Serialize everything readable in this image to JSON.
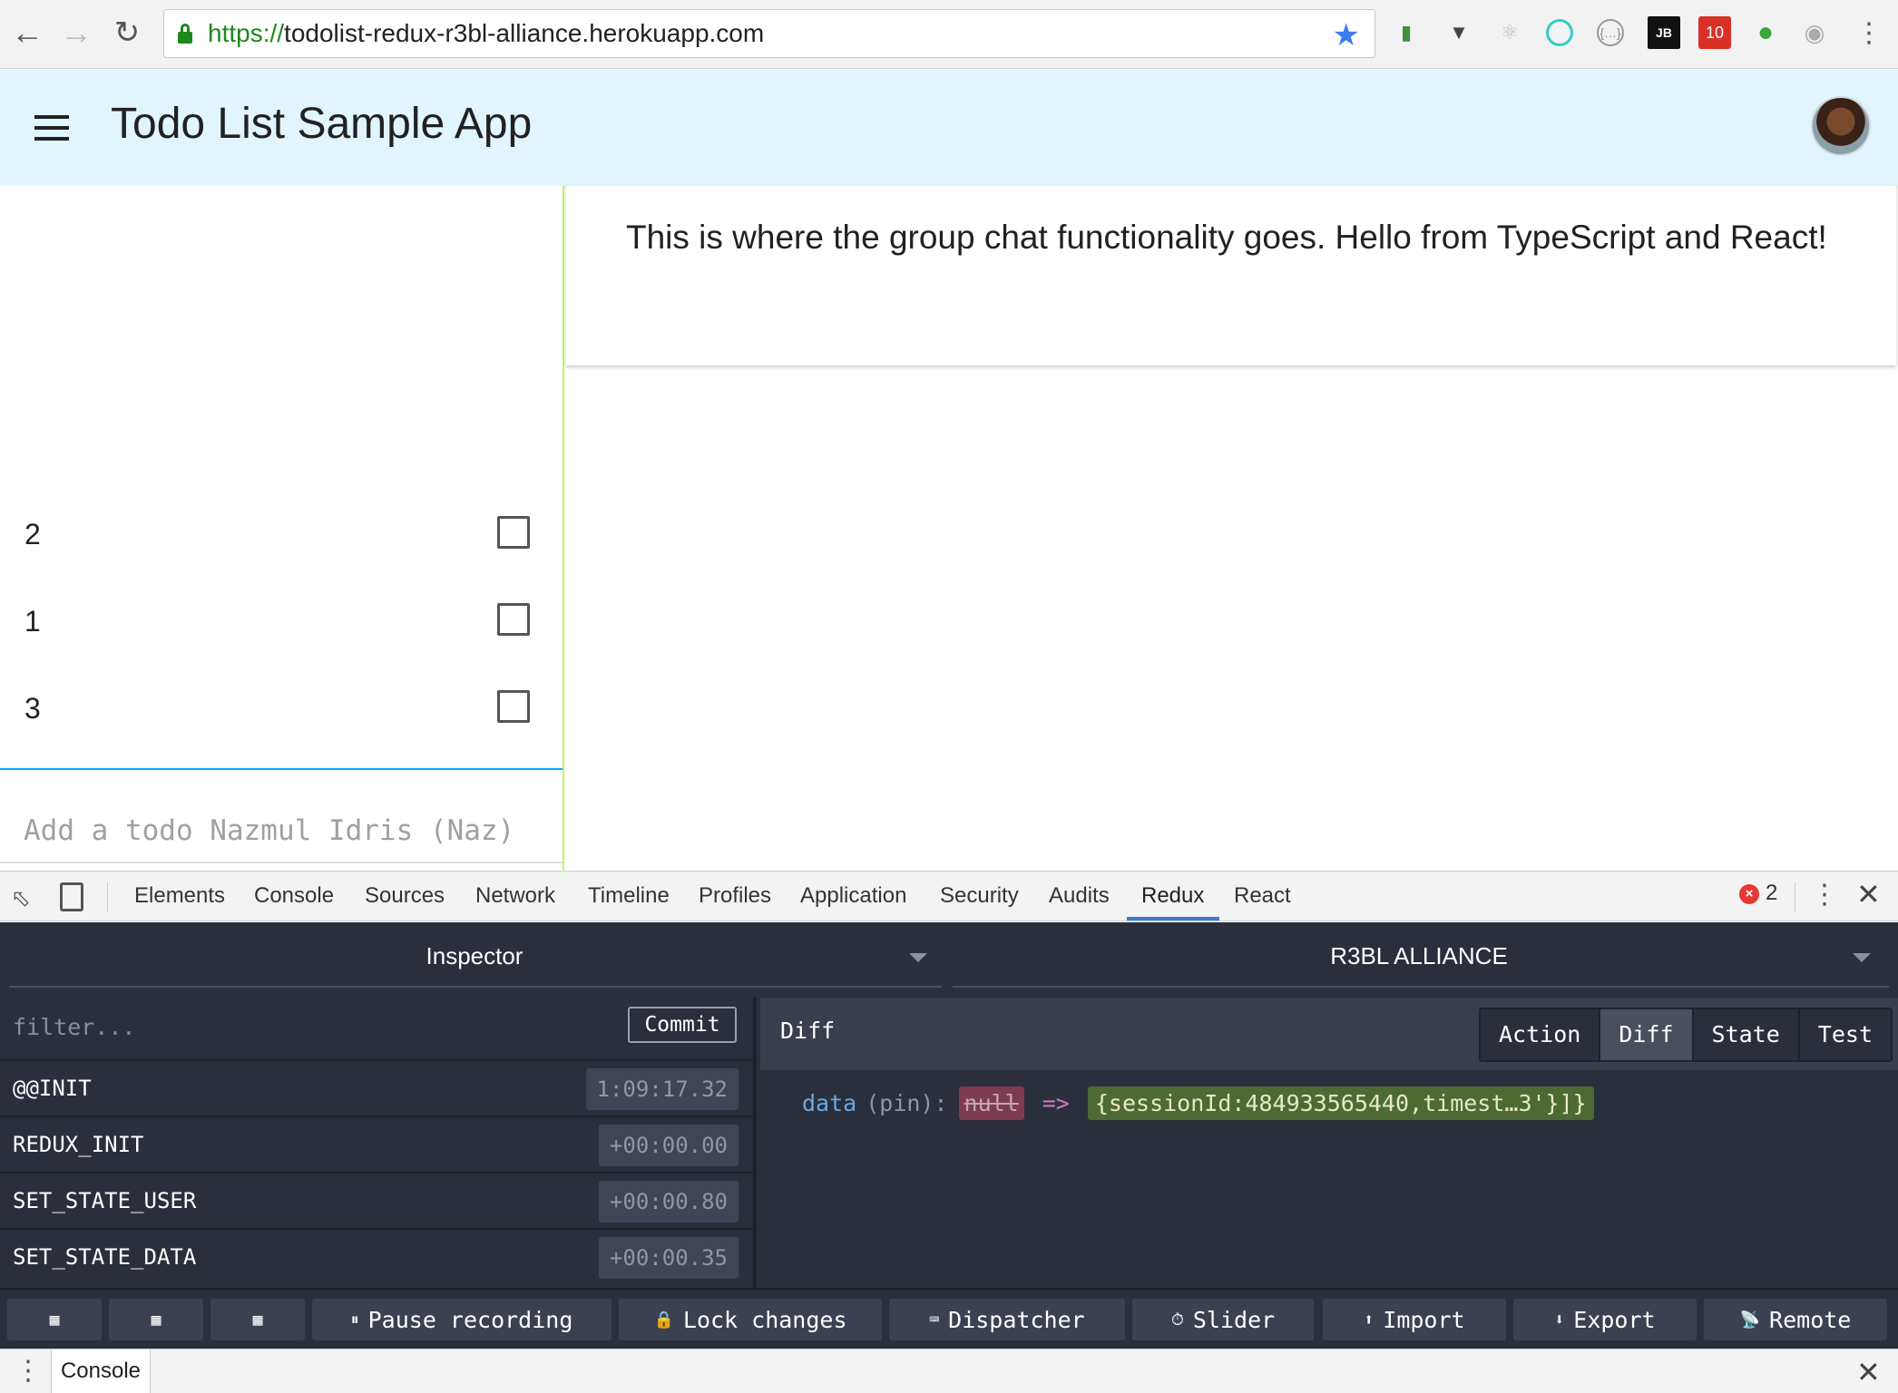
{
  "browser": {
    "url_scheme": "https://",
    "url_host": "todolist-redux-r3bl-alliance.herokuapp.com",
    "extension_badge": "10"
  },
  "app": {
    "title": "Todo List Sample App",
    "todos": [
      {
        "label": "2",
        "checked": false
      },
      {
        "label": "1",
        "checked": false
      },
      {
        "label": "3",
        "checked": false
      }
    ],
    "todo_placeholder": "Add a todo Nazmul Idris (Naz)",
    "chat_message": "This is where the group chat functionality goes. Hello from TypeScript and React!"
  },
  "devtools": {
    "tabs": [
      "Elements",
      "Console",
      "Sources",
      "Network",
      "Timeline",
      "Profiles",
      "Application",
      "Security",
      "Audits",
      "Redux",
      "React"
    ],
    "active_tab": "Redux",
    "error_count": "2",
    "drawer_tab": "Console"
  },
  "redux": {
    "monitor": "Inspector",
    "instance": "R3BL ALLIANCE",
    "filter_placeholder": "filter...",
    "commit_label": "Commit",
    "actions": [
      {
        "name": "@@INIT",
        "time": "1:09:17.32"
      },
      {
        "name": "REDUX_INIT",
        "time": "+00:00.00"
      },
      {
        "name": "SET_STATE_USER",
        "time": "+00:00.80"
      },
      {
        "name": "SET_STATE_DATA",
        "time": "+00:00.35"
      }
    ],
    "pane_title": "Diff",
    "pane_tabs": [
      "Action",
      "Diff",
      "State",
      "Test"
    ],
    "active_pane_tab": "Diff",
    "diff": {
      "key": "data",
      "pin": "(pin):",
      "old": "null",
      "arrow": "=>",
      "new": "{sessionId:484933565440,timest…3'}]}"
    },
    "buttons": {
      "pause": "Pause recording",
      "lock": "Lock changes",
      "dispatcher": "Dispatcher",
      "slider": "Slider",
      "import": "Import",
      "export": "Export",
      "remote": "Remote"
    }
  },
  "colors": {
    "appbar": "#e1f5fe",
    "left_border": "#b2ff59",
    "redux_bg": "#2b2f3b",
    "diff_new_bg": "#4d6a32",
    "diff_old_bg": "#7d3b52"
  }
}
